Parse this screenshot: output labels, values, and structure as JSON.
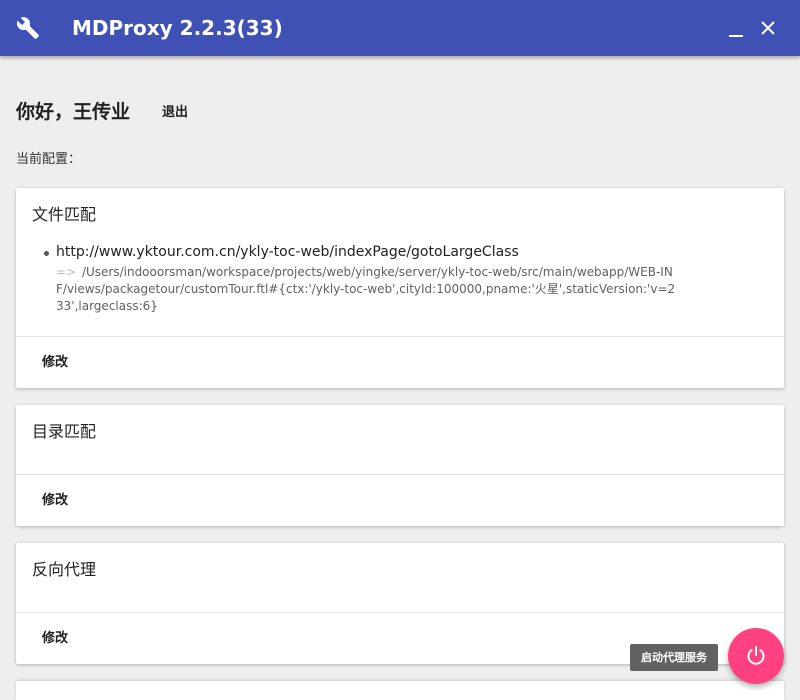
{
  "app": {
    "title": "MDProxy 2.2.3(33)",
    "wrench_icon": "wrench-icon",
    "minimize_icon": "minimize-icon",
    "close_icon": "close-icon"
  },
  "user": {
    "greeting": "你好，王传业",
    "logout_label": "退出"
  },
  "config_label": "当前配置：",
  "sections": [
    {
      "title": "文件匹配",
      "rules": [
        {
          "url": "http://www.yktour.com.cn/ykly-toc-web/indexPage/gotoLargeClass",
          "arrow": "=>",
          "target": "/Users/indooorsman/workspace/projects/web/yingke/server/ykly-toc-web/src/main/webapp/WEB-INF/views/packagetour/customTour.ftl#{ctx:'/ykly-toc-web',cityId:100000,pname:'火星',staticVersion:'v=233',largeclass:6}"
        }
      ],
      "action_label": "修改"
    },
    {
      "title": "目录匹配",
      "rules": [],
      "action_label": "修改"
    },
    {
      "title": "反向代理",
      "rules": [],
      "action_label": "修改"
    }
  ],
  "fab": {
    "tooltip": "启动代理服务",
    "icon": "power-icon",
    "color": "#ff4081"
  },
  "colors": {
    "primary": "#3f51b5",
    "accent": "#ff4081",
    "background": "#eeeeee"
  }
}
